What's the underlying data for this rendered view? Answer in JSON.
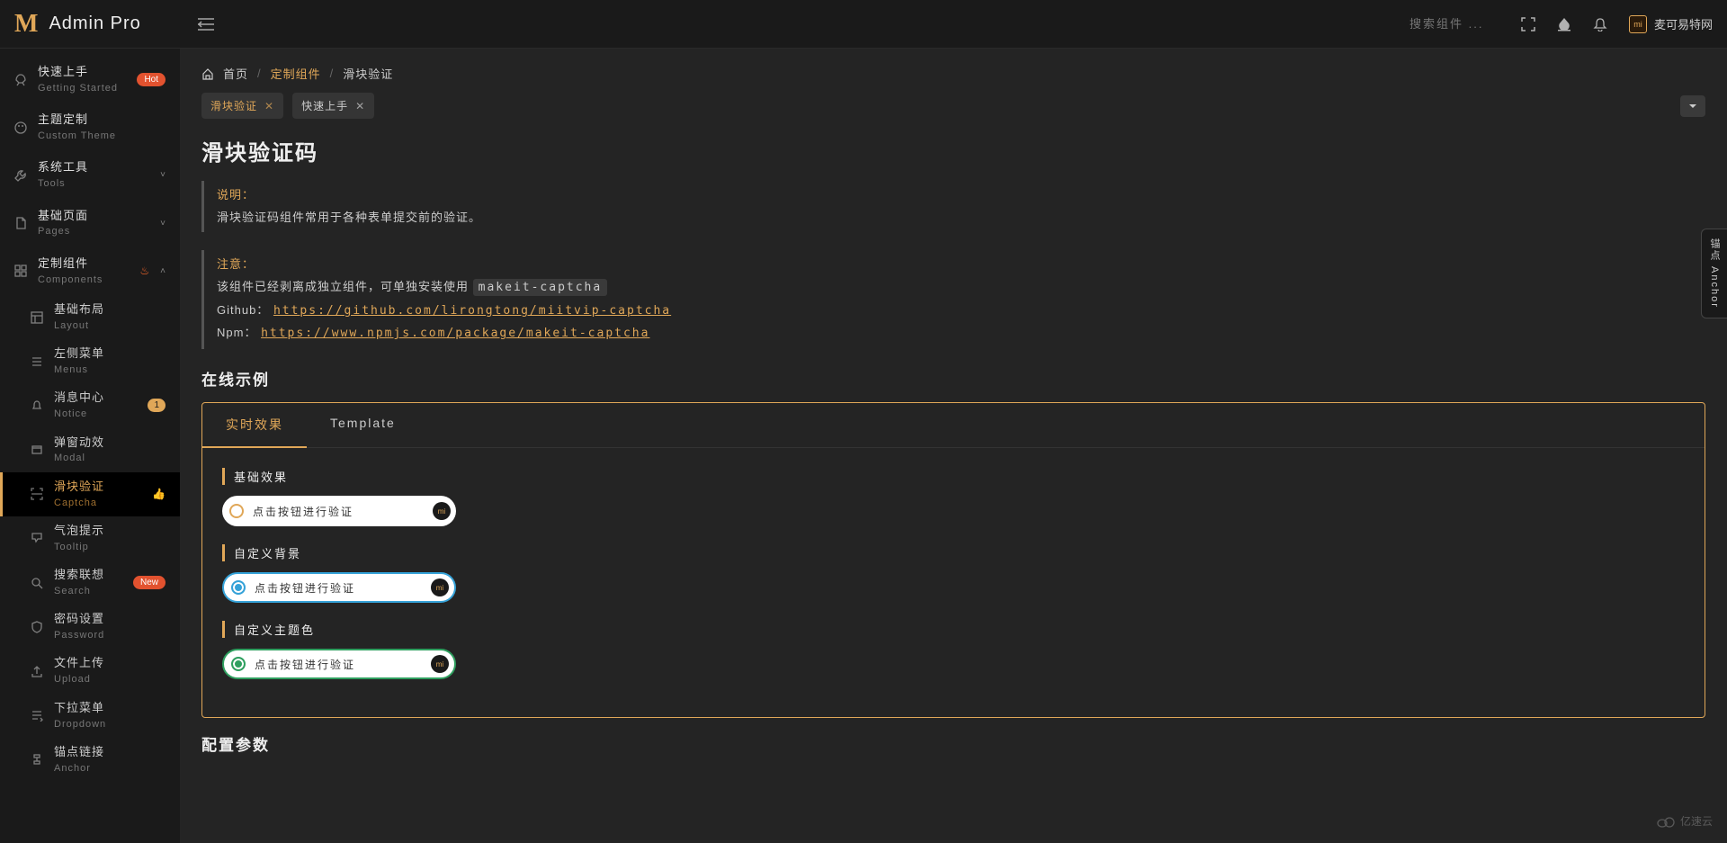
{
  "brand": {
    "icon": "M",
    "name": "Admin Pro"
  },
  "header": {
    "search_placeholder": "搜索组件 ...",
    "username": "麦可易特网",
    "avatar_text": "mi"
  },
  "sidebar": {
    "items": [
      {
        "title": "快速上手",
        "sub": "Getting Started",
        "badge": "Hot",
        "badge_cls": "badge-hot",
        "icon": "rocket"
      },
      {
        "title": "主题定制",
        "sub": "Custom Theme",
        "icon": "palette"
      },
      {
        "title": "系统工具",
        "sub": "Tools",
        "icon": "tool",
        "caret": true
      },
      {
        "title": "基础页面",
        "sub": "Pages",
        "icon": "page",
        "caret": true
      },
      {
        "title": "定制组件",
        "sub": "Components",
        "icon": "comp",
        "caret": true,
        "open": true,
        "extra": "fire",
        "children": [
          {
            "title": "基础布局",
            "sub": "Layout",
            "icon": "layout"
          },
          {
            "title": "左侧菜单",
            "sub": "Menus",
            "icon": "menu"
          },
          {
            "title": "消息中心",
            "sub": "Notice",
            "icon": "bell",
            "count": "1"
          },
          {
            "title": "弹窗动效",
            "sub": "Modal",
            "icon": "modal"
          },
          {
            "title": "滑块验证",
            "sub": "Captcha",
            "icon": "scan",
            "active": true,
            "extra": "thumbs"
          },
          {
            "title": "气泡提示",
            "sub": "Tooltip",
            "icon": "tooltip"
          },
          {
            "title": "搜索联想",
            "sub": "Search",
            "icon": "search",
            "badge": "New",
            "badge_cls": "badge-new"
          },
          {
            "title": "密码设置",
            "sub": "Password",
            "icon": "shield"
          },
          {
            "title": "文件上传",
            "sub": "Upload",
            "icon": "upload"
          },
          {
            "title": "下拉菜单",
            "sub": "Dropdown",
            "icon": "dropdown"
          },
          {
            "title": "锚点链接",
            "sub": "Anchor",
            "icon": "anchor"
          }
        ]
      }
    ]
  },
  "breadcrumb": {
    "home": "首页",
    "mid": "定制组件",
    "cur": "滑块验证"
  },
  "tabs": [
    {
      "label": "滑块验证",
      "active": true
    },
    {
      "label": "快速上手",
      "active": false
    }
  ],
  "page": {
    "title": "滑块验证码",
    "desc_label": "说明：",
    "desc_text": "滑块验证码组件常用于各种表单提交前的验证。",
    "note_label": "注意：",
    "note_text_1": "该组件已经剥离成独立组件，可单独安装使用",
    "note_code": "makeit-captcha",
    "github_label": "Github：",
    "github_link": "https://github.com/lirongtong/miitvip-captcha",
    "npm_label": "Npm：",
    "npm_link": "https://www.npmjs.com/package/makeit-captcha",
    "section_demo": "在线示例",
    "section_config": "配置参数",
    "anchor_handle": "锚点 Anchor"
  },
  "demo": {
    "tab_live": "实时效果",
    "tab_tpl": "Template",
    "group_basic": "基础效果",
    "group_bg": "自定义背景",
    "group_color": "自定义主题色",
    "btn_text": "点击按钮进行验证",
    "logo_text": "mi"
  },
  "watermark": "亿速云"
}
